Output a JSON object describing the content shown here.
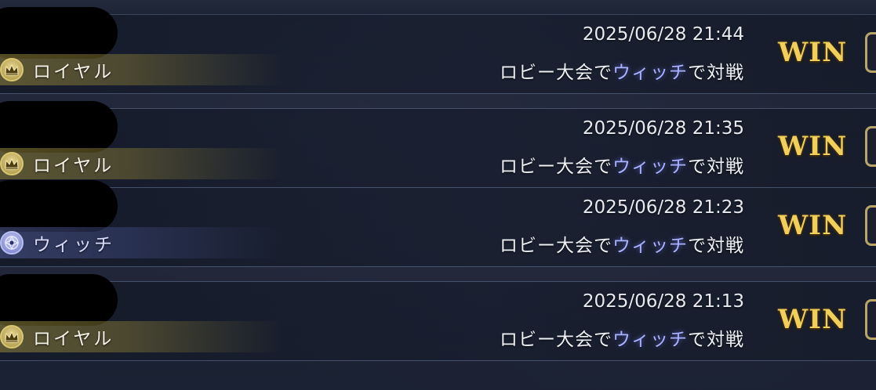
{
  "matches": [
    {
      "player_name": "",
      "class": {
        "type": "royal",
        "name": "ロイヤル",
        "icon": "crown-icon"
      },
      "timestamp": "2025/06/28 21:44",
      "desc_prefix": "ロビー大会で",
      "desc_class": "ウィッチ",
      "desc_suffix": "で対戦",
      "result": "WIN"
    },
    {
      "player_name": "",
      "class": {
        "type": "royal",
        "name": "ロイヤル",
        "icon": "crown-icon"
      },
      "timestamp": "2025/06/28 21:35",
      "desc_prefix": "ロビー大会で",
      "desc_class": "ウィッチ",
      "desc_suffix": "で対戦",
      "result": "WIN"
    },
    {
      "player_name": "",
      "class": {
        "type": "witch",
        "name": "ウィッチ",
        "icon": "magic-circle-icon"
      },
      "timestamp": "2025/06/28 21:23",
      "desc_prefix": "ロビー大会で",
      "desc_class": "ウィッチ",
      "desc_suffix": "で対戦",
      "result": "WIN"
    },
    {
      "player_name": "",
      "class": {
        "type": "royal",
        "name": "ロイヤル",
        "icon": "crown-icon"
      },
      "timestamp": "2025/06/28 21:13",
      "desc_prefix": "ロビー大会で",
      "desc_class": "ウィッチ",
      "desc_suffix": "で対戦",
      "result": "WIN"
    }
  ],
  "colors": {
    "win_gold": "#f2cf5b",
    "witch_highlight": "#a9b3ff",
    "royal_band": "#968738",
    "witch_band": "#505a96"
  }
}
